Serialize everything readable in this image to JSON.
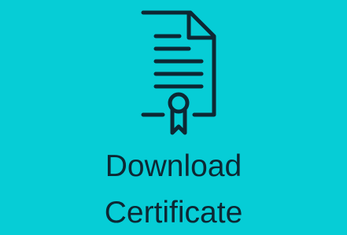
{
  "tile": {
    "label_line_1": "Download",
    "label_line_2": "Certificate",
    "icon": "certificate-icon",
    "background_color": "#06cdd6",
    "foreground_color": "#0d2733"
  }
}
